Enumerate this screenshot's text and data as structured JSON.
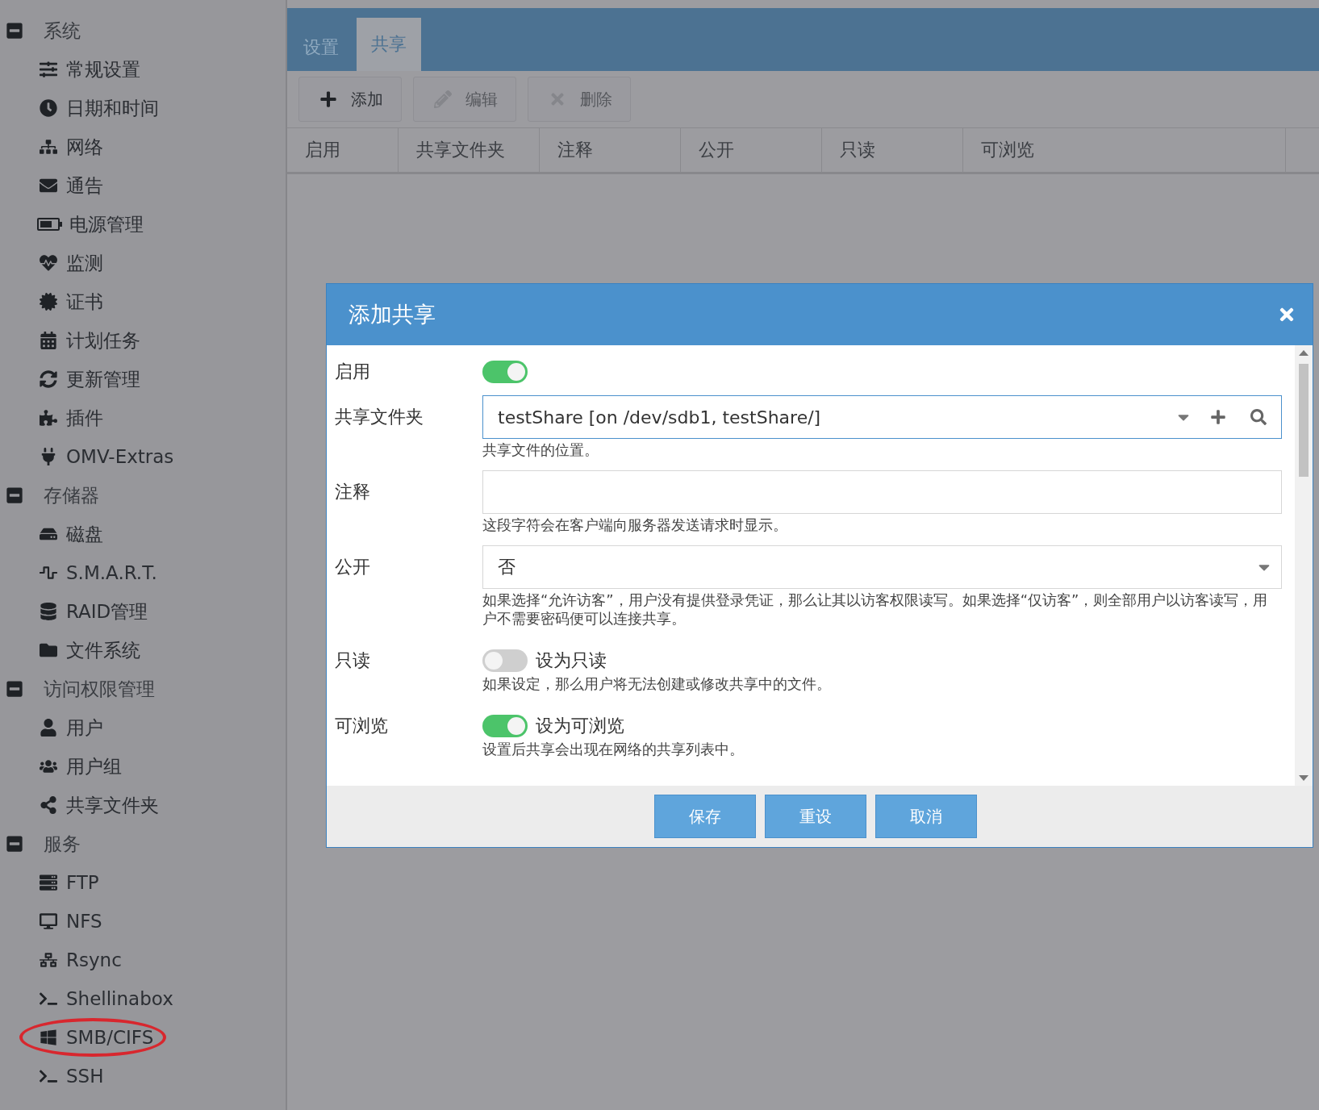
{
  "sidebar": {
    "groups": [
      {
        "title": "系统",
        "expanded": true,
        "items": [
          {
            "label": "常规设置",
            "circled": false
          },
          {
            "label": "日期和时间",
            "circled": false
          },
          {
            "label": "网络",
            "circled": false
          },
          {
            "label": "通告",
            "circled": false
          },
          {
            "label": "电源管理",
            "circled": false
          },
          {
            "label": "监测",
            "circled": false
          },
          {
            "label": "证书",
            "circled": false
          },
          {
            "label": "计划任务",
            "circled": false
          },
          {
            "label": "更新管理",
            "circled": false
          },
          {
            "label": "插件",
            "circled": false
          },
          {
            "label": "OMV-Extras",
            "circled": false
          }
        ]
      },
      {
        "title": "存储器",
        "expanded": true,
        "items": [
          {
            "label": "磁盘",
            "circled": false
          },
          {
            "label": "S.M.A.R.T.",
            "circled": false
          },
          {
            "label": "RAID管理",
            "circled": false
          },
          {
            "label": "文件系统",
            "circled": false
          }
        ]
      },
      {
        "title": "访问权限管理",
        "expanded": true,
        "items": [
          {
            "label": "用户",
            "circled": false
          },
          {
            "label": "用户组",
            "circled": false
          },
          {
            "label": "共享文件夹",
            "circled": false
          }
        ]
      },
      {
        "title": "服务",
        "expanded": true,
        "items": [
          {
            "label": "FTP",
            "circled": false
          },
          {
            "label": "NFS",
            "circled": false
          },
          {
            "label": "Rsync",
            "circled": false
          },
          {
            "label": "Shellinabox",
            "circled": false
          },
          {
            "label": "SMB/CIFS",
            "circled": true
          },
          {
            "label": "SSH",
            "circled": false
          }
        ]
      }
    ]
  },
  "tabs": [
    {
      "label": "设置",
      "selected": false
    },
    {
      "label": "共享",
      "selected": true
    }
  ],
  "toolbar": [
    {
      "label": "添加",
      "disabled": false
    },
    {
      "label": "编辑",
      "disabled": true
    },
    {
      "label": "删除",
      "disabled": true
    }
  ],
  "table": {
    "columns": [
      "启用",
      "共享文件夹",
      "注释",
      "公开",
      "只读",
      "可浏览"
    ]
  },
  "dialog": {
    "title": "添加共享",
    "fields": [
      {
        "kind": "toggle",
        "label": "启用",
        "on": true
      },
      {
        "kind": "combo",
        "label": "共享文件夹",
        "value": "testShare [on /dev/sdb1, testShare/]",
        "hint": "共享文件的位置。"
      },
      {
        "kind": "text",
        "label": "注释",
        "hint": "这段字符会在客户端向服务器发送请求时显示。"
      },
      {
        "kind": "select",
        "label": "公开",
        "value": "否",
        "hint": "如果选择“允许访客”，用户没有提供登录凭证，那么让其以访客权限读写。如果选择“仅访客”，则全部用户以访客读写，用户不需要密码便可以连接共享。"
      },
      {
        "kind": "toggle",
        "label": "只读",
        "on": false,
        "caption": "设为只读",
        "hint": "如果设定，那么用户将无法创建或修改共享中的文件。"
      },
      {
        "kind": "toggle",
        "label": "可浏览",
        "on": true,
        "caption": "设为可浏览",
        "hint": "设置后共享会出现在网络的共享列表中。"
      }
    ],
    "buttons": [
      "保存",
      "重设",
      "取消"
    ]
  }
}
